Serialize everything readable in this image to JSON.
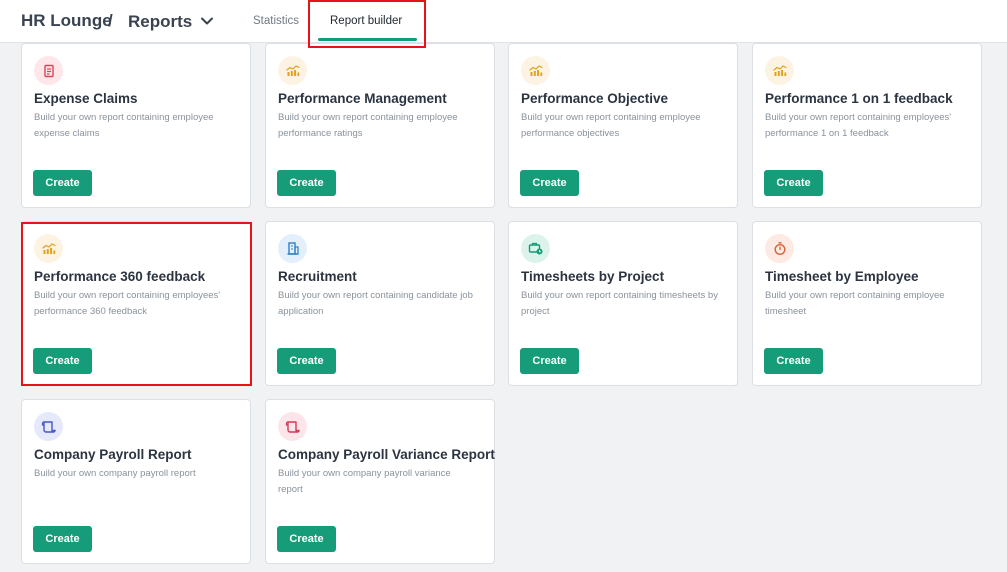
{
  "header": {
    "app_name": "HR Lounge",
    "separator": "/",
    "page_name": "Reports",
    "tabs": [
      {
        "label": "Statistics"
      },
      {
        "label": "Report builder"
      }
    ]
  },
  "cards": [
    {
      "title": "Expense Claims",
      "description": "Build your own report containing employee expense claims",
      "button": "Create",
      "icon": "receipt-icon",
      "icon_bg": "#fde7ea",
      "icon_color": "#d64556"
    },
    {
      "title": "Performance Management",
      "description": "Build your own report containing employee performance ratings",
      "button": "Create",
      "icon": "bar-chart-icon",
      "icon_bg": "#fdf3e3",
      "icon_color": "#e0a21b"
    },
    {
      "title": "Performance Objective",
      "description": "Build your own report containing employee performance objectives",
      "button": "Create",
      "icon": "bar-chart-icon",
      "icon_bg": "#fdf3e3",
      "icon_color": "#e0a21b"
    },
    {
      "title": "Performance 1 on 1 feedback",
      "description": "Build your own report containing employees' performance 1 on 1 feedback",
      "button": "Create",
      "icon": "bar-chart-icon",
      "icon_bg": "#fdf3e3",
      "icon_color": "#e0a21b"
    },
    {
      "title": "Performance 360 feedback",
      "description": "Build your own report containing employees' performance 360 feedback",
      "button": "Create",
      "icon": "bar-chart-icon",
      "icon_bg": "#fdf3e3",
      "icon_color": "#e0a21b"
    },
    {
      "title": "Recruitment",
      "description": "Build your own report containing candidate job application",
      "button": "Create",
      "icon": "building-icon",
      "icon_bg": "#e3f0fb",
      "icon_color": "#2f7fc4"
    },
    {
      "title": "Timesheets by Project",
      "description": "Build your own report containing timesheets by project",
      "button": "Create",
      "icon": "briefcase-clock-icon",
      "icon_bg": "#dcf3ec",
      "icon_color": "#159a76"
    },
    {
      "title": "Timesheet by Employee",
      "description": "Build your own report containing employee timesheet",
      "button": "Create",
      "icon": "stopwatch-icon",
      "icon_bg": "#fdeae3",
      "icon_color": "#d9603a"
    },
    {
      "title": "Company Payroll Report",
      "description": "Build your own company payroll report",
      "button": "Create",
      "icon": "scroll-icon",
      "icon_bg": "#e6e8fb",
      "icon_color": "#4657c7"
    },
    {
      "title": "Company Payroll Variance Report",
      "description": "Build your own company payroll variance report",
      "button": "Create",
      "icon": "scroll-icon",
      "icon_bg": "#fde6ea",
      "icon_color": "#d23a55"
    }
  ],
  "colors": {
    "accent": "#169c78",
    "highlight": "#e8121b"
  }
}
